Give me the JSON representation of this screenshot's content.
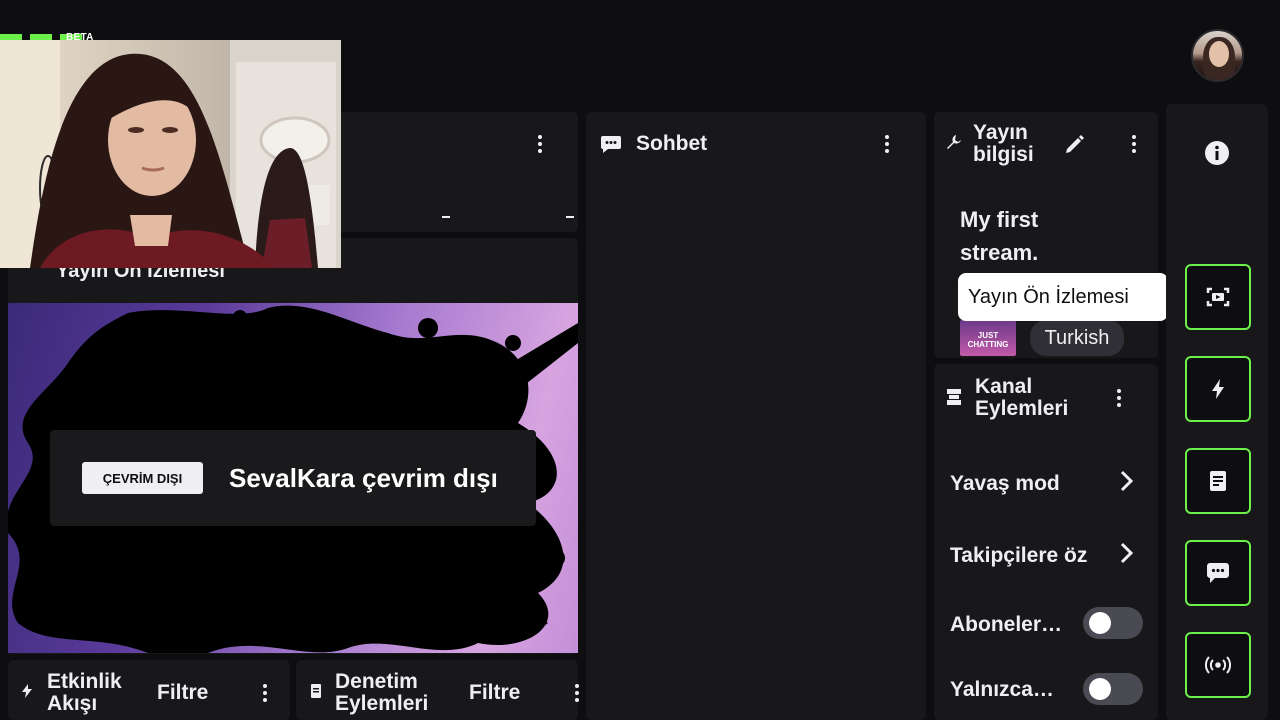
{
  "app": {
    "beta_label": "BETA"
  },
  "panels": {
    "preview": {
      "title": "Yayın Ön İzlemesi",
      "offline_badge": "ÇEVRİM DIŞI",
      "offline_message": "SevalKara çevrim dışı"
    },
    "chat": {
      "title": "Sohbet"
    },
    "stream_info": {
      "title_line1": "Yayın",
      "title_line2": "bilgisi",
      "stream_title_line1": "My first",
      "stream_title_line2": "stream.",
      "category_art_text_line1": "JUST",
      "category_art_text_line2": "CHATTING",
      "language": "Turkish"
    },
    "channel_actions": {
      "title_line1": "Kanal",
      "title_line2": "Eylemleri",
      "items": [
        {
          "label": "Yavaş mod",
          "control": "chevron"
        },
        {
          "label": "Takipçilere öz",
          "control": "chevron"
        },
        {
          "label": "Aboneler…",
          "control": "toggle",
          "on": false
        },
        {
          "label": "Yalnızca…",
          "control": "toggle",
          "on": false
        }
      ]
    },
    "activity_feed": {
      "title_line1": "Etkinlik",
      "title_line2": "Akışı",
      "filter_label": "Filtre"
    },
    "mod_actions": {
      "title_line1": "Denetim",
      "title_line2": "Eylemleri",
      "filter_label": "Filtre"
    }
  },
  "tooltip": {
    "text": "Yayın Ön İzlemesi"
  },
  "rail": {
    "info_icon": "info-icon",
    "buttons": [
      "stream-preview-icon",
      "lightning-icon",
      "notes-icon",
      "chat-bubble-icon",
      "broadcast-icon"
    ]
  },
  "colors": {
    "accent": "#6cf04a",
    "panel": "#18181b",
    "background": "#0e0e10"
  }
}
